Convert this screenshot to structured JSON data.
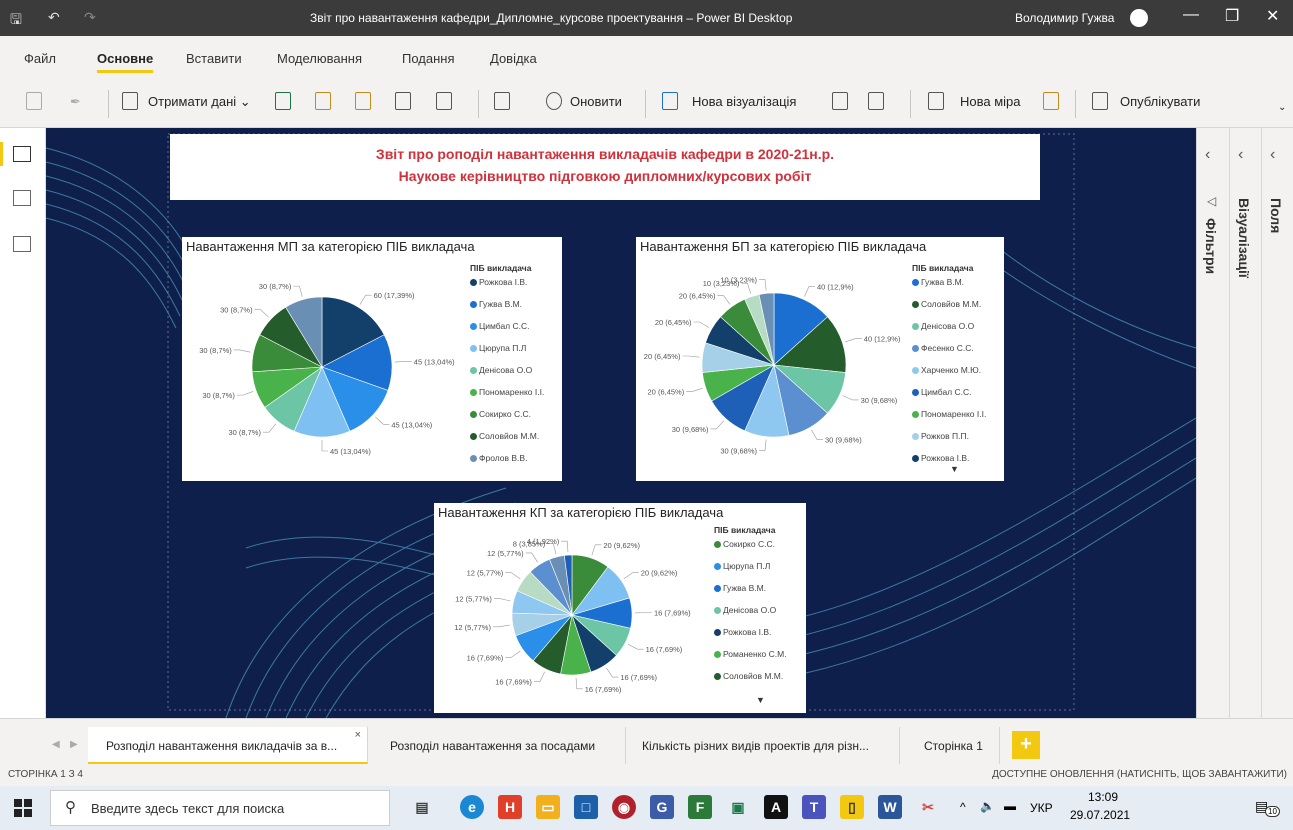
{
  "window": {
    "title": "Звіт про навантаження кафедри_Дипломне_курсове проектування – Power BI Desktop",
    "user": "Володимир Гужва"
  },
  "menu": [
    "Файл",
    "Основне",
    "Вставити",
    "Моделювання",
    "Подання",
    "Довідка"
  ],
  "ribbon": {
    "get_data": "Отримати дані",
    "refresh": "Оновити",
    "new_visual": "Нова візуалізація",
    "new_measure": "Нова міра",
    "publish": "Опублікувати"
  },
  "panes": {
    "filters": "Фільтри",
    "visualizations": "Візуалізації",
    "fields": "Поля"
  },
  "report_title": {
    "line1": "Звіт про роподіл навантаження викладачів кафедри в 2020-21н.р.",
    "line2": "Наукове керівництво підговкою дипломних/курсових робіт"
  },
  "legend_title": "ПІБ викладача",
  "chart_data": [
    {
      "type": "pie",
      "title": "Навантаження МП за категорією ПІБ викладача",
      "categories": [
        "Рожкова І.В.",
        "Гужва В.М.",
        "Цимбал С.С.",
        "Цюрупа П.Л",
        "Денісова О.О",
        "Пономаренко І.І.",
        "Сокирко С.С.",
        "Соловйов М.М.",
        "Фролов В.В."
      ],
      "values": [
        60,
        45,
        45,
        45,
        30,
        30,
        30,
        30,
        30
      ],
      "colors": [
        "#12406b",
        "#1a6fd1",
        "#2a8fe8",
        "#7ec0f2",
        "#6cc6a5",
        "#4ab24a",
        "#3a8c3a",
        "#245c2b",
        "#6a8fb5"
      ],
      "labels": [
        "60 (17,39%)",
        "45 (13,04%)",
        "45 (13,04%)",
        "45 (13,04%)",
        "30 (8,7%)",
        "30 (8,7%)",
        "30 (8,7%)",
        "30 (8,7%)",
        "30 (8,7%)"
      ]
    },
    {
      "type": "pie",
      "title": "Навантаження БП за категорією ПІБ викладача",
      "categories": [
        "Гужва В.М.",
        "Соловйов М.М.",
        "Денісова О.О",
        "Фесенко С.С.",
        "Харченко М.Ю.",
        "Цимбал С.С.",
        "Пономаренко І.І.",
        "Рожков П.П.",
        "Рожкова І.В."
      ],
      "legend_colors": [
        "#1a6fd1",
        "#245c2b",
        "#6cc6a5",
        "#5b8fd0",
        "#8ec8f0",
        "#1e5fb8",
        "#4ab24a",
        "#a6cfe8",
        "#12406b"
      ],
      "values": [
        40,
        40,
        30,
        30,
        30,
        30,
        20,
        20,
        20,
        20,
        10,
        10
      ],
      "colors": [
        "#1a6fd1",
        "#245c2b",
        "#6cc6a5",
        "#5b8fd0",
        "#8ec8f0",
        "#1e5fb8",
        "#4ab24a",
        "#a6cfe8",
        "#12406b",
        "#3a8c3a",
        "#b7dcc3",
        "#6a8fb5"
      ],
      "labels": [
        "40 (12,9%)",
        "40 (12,9%)",
        "30 (9,68%)",
        "30 (9,68%)",
        "30 (9,68%)",
        "30 (9,68%)",
        "20 (6,45%)",
        "20 (6,45%)",
        "20 (6,45%)",
        "20 (6,45%)",
        "10 (3,23%)",
        "10 (3,23%)"
      ]
    },
    {
      "type": "pie",
      "title": "Навантаження КП за категорією ПІБ викладача",
      "categories": [
        "Сокирко С.С.",
        "Цюрупа П.Л",
        "Гужва В.М.",
        "Денісова О.О",
        "Рожкова І.В.",
        "Романенко С.М.",
        "Соловйов М.М."
      ],
      "legend_colors": [
        "#3a8c3a",
        "#2a8fe8",
        "#1a6fd1",
        "#6cc6a5",
        "#12406b",
        "#4ab24a",
        "#245c2b"
      ],
      "values": [
        20,
        20,
        16,
        16,
        16,
        16,
        16,
        16,
        12,
        12,
        12,
        12,
        8,
        4
      ],
      "colors": [
        "#3a8c3a",
        "#7ec0f2",
        "#1a6fd1",
        "#6cc6a5",
        "#12406b",
        "#4ab24a",
        "#245c2b",
        "#2a8fe8",
        "#a6cfe8",
        "#8ec8f0",
        "#b7dcc3",
        "#5b8fd0",
        "#6a8fb5",
        "#1e5fb8"
      ],
      "labels": [
        "20 (9,62%)",
        "20 (9,62%)",
        "16 (7,69%)",
        "16 (7,69%)",
        "16 (7,69%)",
        "16 (7,69%)",
        "16 (7,69%)",
        "16 (7,69%)",
        "12 (5,77%)",
        "12 (5,77%)",
        "12 (5,77%)",
        "12 (5,77%)",
        "8 (3,85%)",
        "4 (1,92%)"
      ]
    }
  ],
  "tabs": [
    "Розподіл навантаження викладачів за в...",
    "Розподіл навантаження за посадами",
    "Кількість різних видів проектів для різн...",
    "Сторінка 1"
  ],
  "status": {
    "page": "СТОРІНКА 1 З 4",
    "update": "ДОСТУПНЕ ОНОВЛЕННЯ (НАТИСНІТЬ, ЩОБ ЗАВАНТАЖИТИ)"
  },
  "taskbar": {
    "search_placeholder": "Введите здесь текст для поиска",
    "lang": "УКР",
    "time": "13:09",
    "date": "29.07.2021",
    "notifications": "10"
  }
}
